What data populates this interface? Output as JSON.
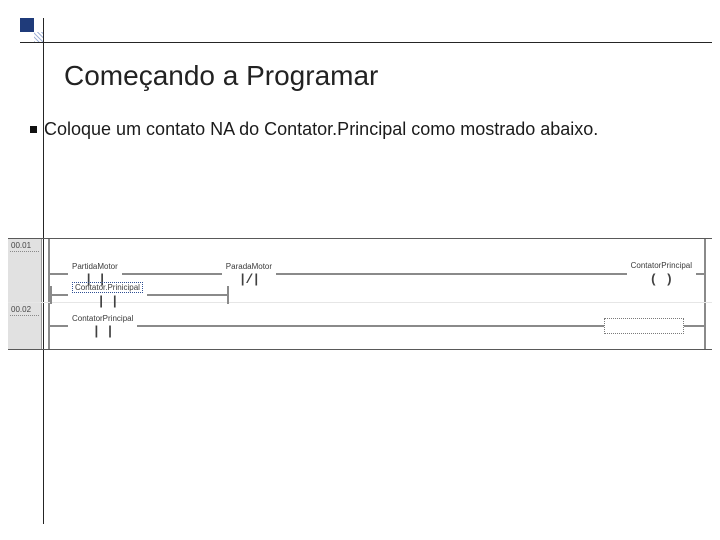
{
  "slide": {
    "title": "Começando a Programar",
    "bullet_text": "Coloque um contato NA do Contator.Principal como mostrado abaixo."
  },
  "ladder": {
    "rung1": {
      "number": "00.01",
      "contact1": {
        "label": "PartidaMotor",
        "symbol": "| |"
      },
      "contact2": {
        "label": "ParadaMotor",
        "symbol": "|/|"
      },
      "coil": {
        "label": "ContatorPrincipal",
        "symbol": "( )"
      },
      "branch_contact": {
        "label": "Contator.Prinicipal",
        "symbol": "| |"
      }
    },
    "rung2": {
      "number": "00.02",
      "contact": {
        "label": "ContatorPrincipal",
        "symbol": "| |"
      }
    }
  }
}
